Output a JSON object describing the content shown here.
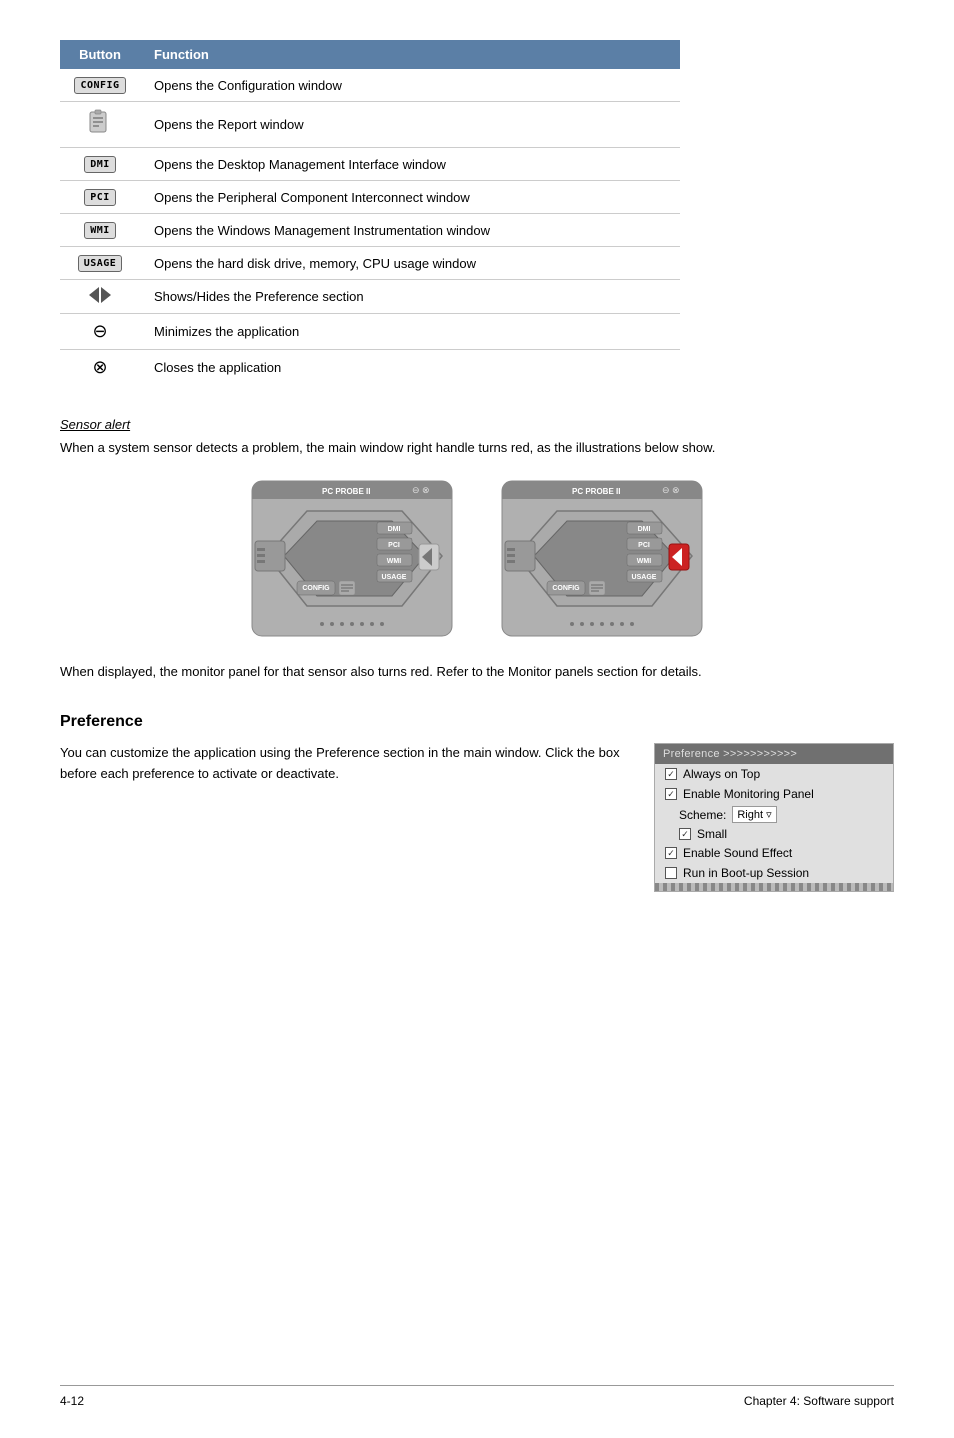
{
  "table": {
    "col1": "Button",
    "col2": "Function",
    "rows": [
      {
        "button_label": "CONFIG",
        "button_type": "text-btn",
        "function": "Opens the Configuration window"
      },
      {
        "button_label": "report-icon",
        "button_type": "icon",
        "function": "Opens the Report window"
      },
      {
        "button_label": "DMI",
        "button_type": "text-btn",
        "function": "Opens the Desktop Management Interface window"
      },
      {
        "button_label": "PCI",
        "button_type": "text-btn",
        "function": "Opens the Peripheral Component Interconnect window"
      },
      {
        "button_label": "WMI",
        "button_type": "text-btn",
        "function": "Opens the Windows Management Instrumentation window"
      },
      {
        "button_label": "USAGE",
        "button_type": "text-btn",
        "function": "Opens the hard disk drive, memory, CPU usage window"
      },
      {
        "button_label": "arrows",
        "button_type": "arrows",
        "function": "Shows/Hides the Preference section"
      },
      {
        "button_label": "minimize-icon",
        "button_type": "unicode",
        "unicode": "⊖",
        "function": "Minimizes the application"
      },
      {
        "button_label": "close-icon",
        "button_type": "unicode",
        "unicode": "⊗",
        "function": "Closes the application"
      }
    ]
  },
  "sensor_alert": {
    "title": "Sensor alert",
    "description": "When a system sensor detects a problem, the main window right handle\nturns red, as the illustrations below show.",
    "after_text": "When displayed, the monitor panel for that sensor also turns red. Refer to the\nMonitor panels section for details."
  },
  "preference": {
    "title": "Preference",
    "text": "You can customize the application using\nthe Preference section in the main window.\nClick the box before each preference to\nactivate or deactivate.",
    "panel_header": "Preference >>>>>>>>>>>",
    "items": [
      {
        "label": "Always on Top",
        "checked": true
      },
      {
        "label": "Enable Monitoring Panel",
        "checked": true
      },
      {
        "label": "scheme_row",
        "type": "scheme",
        "scheme_label": "Scheme:",
        "scheme_value": "Right"
      },
      {
        "label": "Small",
        "checked": true,
        "indent": true
      },
      {
        "label": "Enable Sound Effect",
        "checked": true
      },
      {
        "label": "Run in Boot-up Session",
        "checked": false
      }
    ]
  },
  "footer": {
    "left": "4-12",
    "right": "Chapter 4: Software support"
  }
}
